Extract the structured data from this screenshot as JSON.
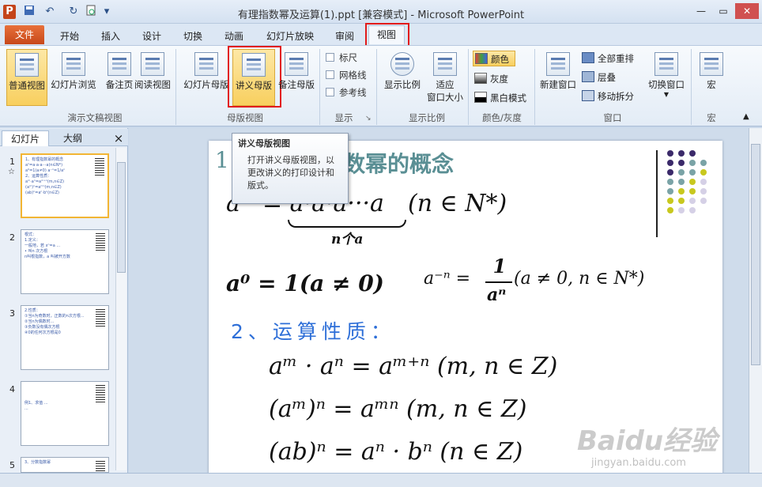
{
  "window": {
    "title": "有理指数幂及运算(1).ppt [兼容模式] - Microsoft PowerPoint"
  },
  "qat": {
    "app_icon": "P",
    "save": "save-icon",
    "undo": "undo-icon",
    "redo": "redo-icon",
    "print": "print-preview-icon"
  },
  "tabs": [
    "文件",
    "开始",
    "插入",
    "设计",
    "切换",
    "动画",
    "幻灯片放映",
    "审阅",
    "视图"
  ],
  "ribbon": {
    "groups": {
      "presentation_views": "演示文稿视图",
      "master_views": "母版视图",
      "show": "显示",
      "zoom": "显示比例",
      "color": "颜色/灰度",
      "window": "窗口",
      "macros": "宏"
    },
    "normal": "普通视图",
    "sorter": "幻灯片浏览",
    "notes_page": "备注页",
    "reading": "阅读视图",
    "slide_master": "幻灯片母版",
    "handout_master": "讲义母版",
    "notes_master": "备注母版",
    "ruler": "标尺",
    "gridlines": "网格线",
    "guides": "参考线",
    "zoom": "显示比例",
    "fit": "适应\n窗口大小",
    "color": "颜色",
    "grayscale": "灰度",
    "bw": "黑白模式",
    "new_window": "新建窗口",
    "arrange_all": "全部重排",
    "cascade": "层叠",
    "move_split": "移动拆分",
    "switch_windows": "切换窗口",
    "macro": "宏"
  },
  "left_pane": {
    "tabs": [
      "幻灯片",
      "大纲"
    ],
    "close": "×",
    "thumb_numbers": [
      "1",
      "2",
      "3",
      "4",
      "5"
    ]
  },
  "tooltip": {
    "title": "讲义母版视图",
    "desc": "打开讲义母版视图，以更改讲义的打印设计和版式。"
  },
  "slide": {
    "heading_num": "1",
    "heading_text": "数幂的概念",
    "eq1_left": "a",
    "eq1_mid": "= a·a·a···a",
    "eq1_right": "(n ∈ N*)",
    "eq1_brace": "n个a",
    "eq2": "a⁰ = 1(a ≠ 0)",
    "eq3_left": "a⁻ⁿ =",
    "eq3_num": "1",
    "eq3_den": "aⁿ",
    "eq3_right": "(a ≠ 0, n ∈ N*)",
    "section2": "2、运算性质：",
    "rule1": "aᵐ · aⁿ = aᵐ⁺ⁿ (m, n ∈ Z)",
    "rule2": "(aᵐ)ⁿ = aᵐⁿ (m, n ∈ Z)",
    "rule3": "(ab)ⁿ = aⁿ · bⁿ (n ∈ Z)"
  },
  "watermark": {
    "main": "Baidu经验",
    "sub": "jingyan.baidu.com"
  },
  "colors": {
    "accent_red": "#e21b1b",
    "heading": "#5a8f94",
    "section": "#2e6fd8",
    "dots_purple": "#3b2a6a",
    "dots_teal": "#7aa3a6",
    "dots_yellow": "#c8c81e",
    "dots_lilac": "#d5d0e6"
  }
}
